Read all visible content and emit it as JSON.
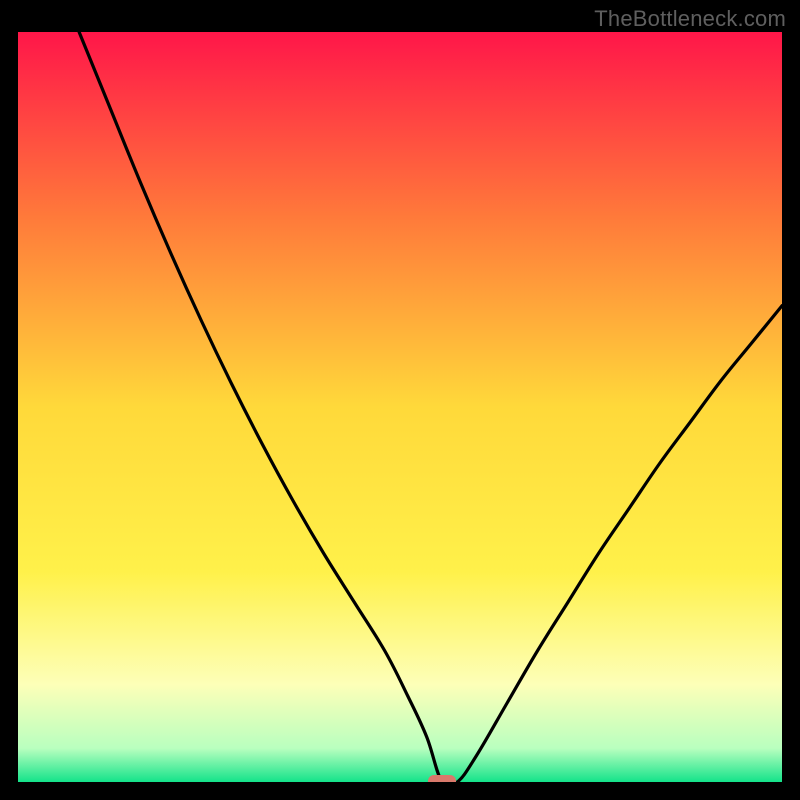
{
  "watermark": "TheBottleneck.com",
  "chart_data": {
    "type": "line",
    "title": "",
    "xlabel": "",
    "ylabel": "",
    "xlim": [
      0,
      100
    ],
    "ylim": [
      0,
      100
    ],
    "grid": false,
    "legend": false,
    "background_gradient": {
      "stops": [
        {
          "pos": 0.0,
          "color": "#ff1649"
        },
        {
          "pos": 0.25,
          "color": "#ff7b3a"
        },
        {
          "pos": 0.5,
          "color": "#ffd93a"
        },
        {
          "pos": 0.72,
          "color": "#fff14a"
        },
        {
          "pos": 0.87,
          "color": "#fdffb8"
        },
        {
          "pos": 0.955,
          "color": "#b9ffbf"
        },
        {
          "pos": 1.0,
          "color": "#14e38a"
        }
      ]
    },
    "marker": {
      "x": 55.5,
      "y": 0,
      "color": "#d9796b"
    },
    "series": [
      {
        "name": "curve",
        "x": [
          8,
          12,
          16,
          20,
          24,
          28,
          32,
          36,
          40,
          44,
          48,
          51,
          53.5,
          55.5,
          57.5,
          60,
          64,
          68,
          72,
          76,
          80,
          84,
          88,
          92,
          96,
          100
        ],
        "y": [
          100,
          90,
          80,
          70.5,
          61.5,
          53,
          45,
          37.5,
          30.5,
          24,
          17.5,
          11.5,
          6,
          0,
          0,
          3.5,
          10.5,
          17.5,
          24,
          30.5,
          36.5,
          42.5,
          48,
          53.5,
          58.5,
          63.5
        ]
      }
    ]
  }
}
